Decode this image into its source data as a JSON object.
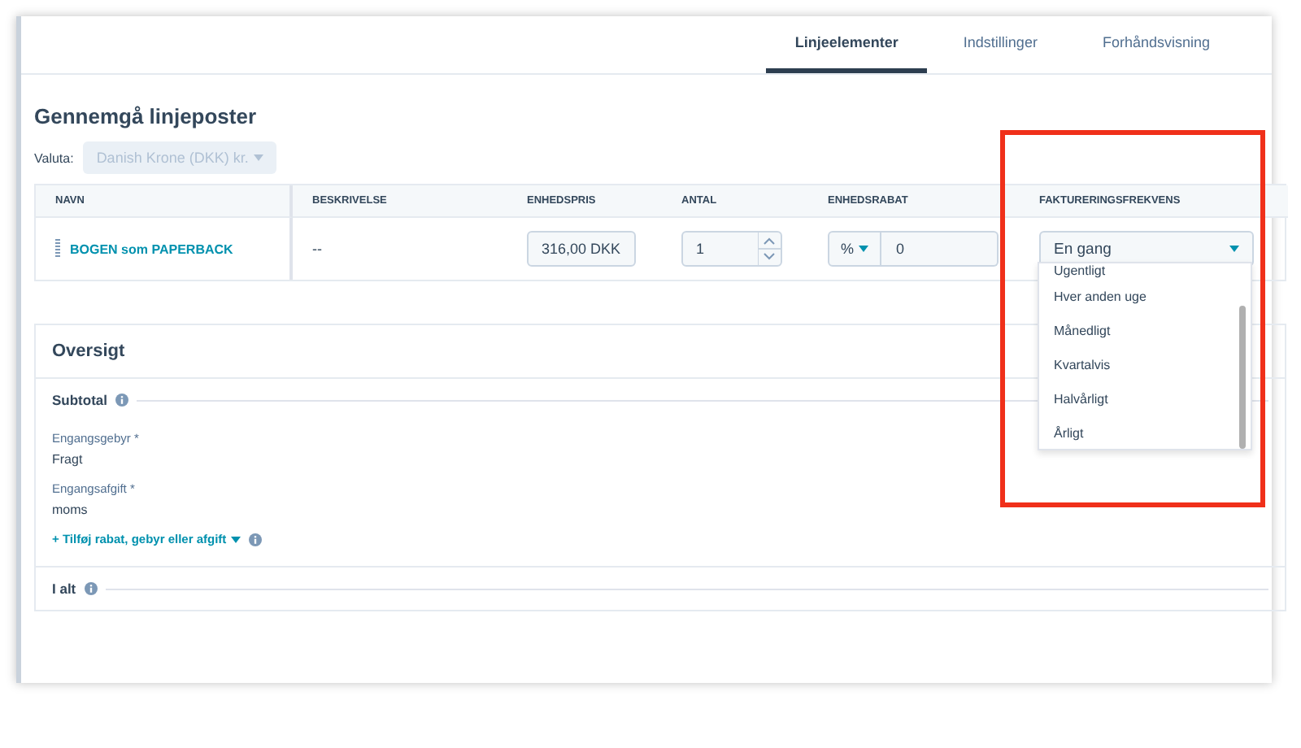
{
  "tabs": [
    {
      "label": "Linjeelementer",
      "selected": true
    },
    {
      "label": "Indstillinger",
      "selected": false
    },
    {
      "label": "Forhåndsvisning",
      "selected": false
    }
  ],
  "section_title": "Gennemgå linjeposter",
  "currency": {
    "label": "Valuta:",
    "value": "Danish Krone (DKK) kr.",
    "disabled": true
  },
  "table": {
    "columns": [
      "NAVN",
      "BESKRIVELSE",
      "ENHEDSPRIS",
      "ANTAL",
      "ENHEDSRABAT",
      "FAKTURERINGSFREKVENS"
    ],
    "rows": [
      {
        "name": "BOGEN som PAPERBACK",
        "description": "--",
        "unit_price": "316,00 DKK",
        "quantity": "1",
        "discount_type": "%",
        "discount": "0",
        "frequency": "En gang"
      }
    ]
  },
  "frequency_menu": {
    "options": [
      "Ugentligt",
      "Hver anden uge",
      "Månedligt",
      "Kvartalvis",
      "Halvårligt",
      "Årligt"
    ]
  },
  "overview": {
    "title": "Oversigt",
    "subtotal": "Subtotal",
    "fields": [
      {
        "label": "Engangsgebyr *",
        "value": "Fragt"
      },
      {
        "label": "Engangsafgift *",
        "value": "moms"
      }
    ],
    "add_link": "+ Tilføj rabat, gebyr eller afgift",
    "total": "I alt"
  }
}
